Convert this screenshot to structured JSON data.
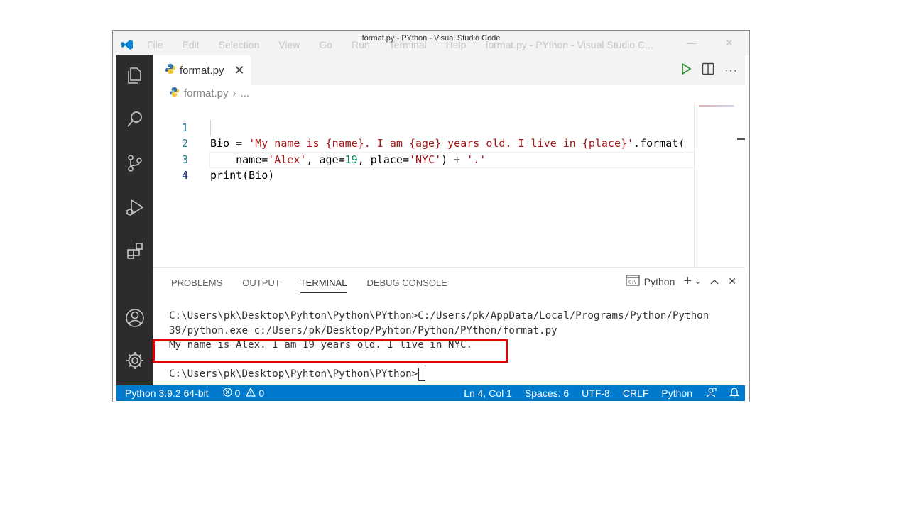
{
  "window": {
    "title": "format.py - PYthon - Visual Studio Code",
    "menu": [
      "File",
      "Edit",
      "Selection",
      "View",
      "Go",
      "Run",
      "Terminal",
      "Help",
      "format.py - PYthon - Visual Studio C..."
    ]
  },
  "editor": {
    "tab_label": "format.py",
    "breadcrumb_file": "format.py",
    "breadcrumb_more": "...",
    "lines": [
      {
        "number": "1",
        "a": "Bio = ",
        "s1": "'My name is {name}. I am {age} years old. I live in {place}'",
        "b": ".format("
      },
      {
        "number": "2",
        "a": "    name=",
        "s1": "'Alex'",
        "b": ", age=",
        "n1": "19",
        "c": ", place=",
        "s2": "'NYC'",
        "d": ") + ",
        "s3": "'.'"
      },
      {
        "number": "3",
        "a": "print(Bio)"
      },
      {
        "number": "4"
      }
    ]
  },
  "panel": {
    "tabs": [
      "PROBLEMS",
      "OUTPUT",
      "TERMINAL",
      "DEBUG CONSOLE"
    ],
    "active_tab": "TERMINAL",
    "terminal_name": "Python",
    "terminal_lines": [
      "C:\\Users\\pk\\Desktop\\Pyhton\\Python\\PYthon>C:/Users/pk/AppData/Local/Programs/Python/Python",
      "39/python.exe c:/Users/pk/Desktop/Pyhton/Python/PYthon/format.py",
      "My name is Alex. I am 19 years old. I live in NYC.",
      "",
      "C:\\Users\\pk\\Desktop\\Pyhton\\Python\\PYthon>"
    ]
  },
  "status": {
    "interpreter": "Python 3.9.2 64-bit",
    "errors": "0",
    "warnings": "0",
    "position": "Ln 4, Col 1",
    "spaces": "Spaces: 6",
    "encoding": "UTF-8",
    "eol": "CRLF",
    "language": "Python"
  },
  "colors": {
    "accent": "#007acc",
    "string": "#a31515",
    "number": "#098658",
    "highlight_box": "#e00000"
  }
}
